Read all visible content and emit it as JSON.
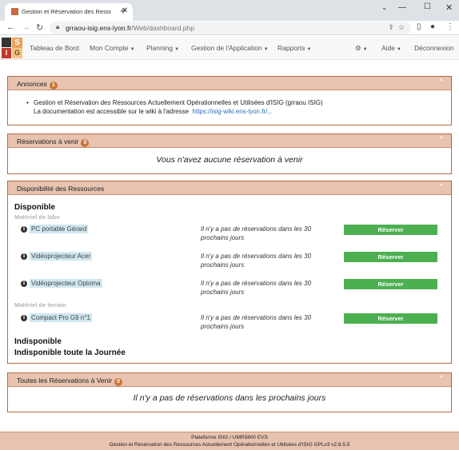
{
  "browser": {
    "tab_title": "Gestion et Réservation des Ressources",
    "url_host": "grraou-isig.ens-lyon.fr",
    "url_path": "/Web/dashboard.php"
  },
  "nav": {
    "items": [
      {
        "label": "Tableau de Bord",
        "dropdown": false
      },
      {
        "label": "Mon Compte",
        "dropdown": true
      },
      {
        "label": "Planning",
        "dropdown": true
      },
      {
        "label": "Gestion de l'Application",
        "dropdown": true
      },
      {
        "label": "Rapports",
        "dropdown": true
      }
    ],
    "help_label": "Aide",
    "logout_label": "Déconnexion",
    "logo_letters": [
      "",
      "S",
      "I",
      "G"
    ]
  },
  "announcements": {
    "title": "Annonces",
    "count": "1",
    "line1": "Gestion et Réservation des Ressources Actuellement Opérationnelles et Utilisées d'ISIG (grraou ISIG)",
    "line2": "La documentation est accessible sur le wiki à l'adresse",
    "link": "https://isig-wiki.ens-lyon.fr/..."
  },
  "upcoming": {
    "title": "Réservations à venir",
    "count": "0",
    "empty": "Vous n'avez aucune réservation à venir"
  },
  "availability": {
    "title": "Disponibilité des Ressources",
    "available_label": "Disponible",
    "categories": [
      {
        "name": "Matériel de labo",
        "resources": [
          {
            "name": "PC portable Gérard",
            "status": "Il n'y a pas de réservations dans les 30 prochains jours",
            "action": "Réserver"
          },
          {
            "name": "Vidéoprojecteur Acer",
            "status": "Il n'y a pas de réservations dans les 30 prochains jours",
            "action": "Réserver"
          },
          {
            "name": "Vidéoprojecteur Optoma",
            "status": "Il n'y a pas de réservations dans les 30 prochains jours",
            "action": "Réserver"
          }
        ]
      },
      {
        "name": "Matériel de terrain",
        "resources": [
          {
            "name": "Compact Pro G9 n°1",
            "status": "Il n'y a pas de réservations dans les 30 prochains jours",
            "action": "Réserver"
          }
        ]
      }
    ],
    "unavailable_label": "Indisponible",
    "unavailable_all_day_label": "Indisponible toute la Journée"
  },
  "all_upcoming": {
    "title": "Toutes les Réservations à Venir",
    "count": "0",
    "empty": "Il n'y a pas de réservations dans les prochains jours"
  },
  "footer": {
    "line1": "Plateforme ISIG / UMR5600 EVS",
    "line2": "Gestion et Réservation des Ressources Actuellement Opérationnelles et Utilisées d'ISIG GPLv3 v2.8.5.5"
  },
  "colors": {
    "panel_header": "#e7c3b0",
    "panel_border": "#b06a45",
    "badge": "#c9753a",
    "reserve_button": "#4caf50",
    "resource_highlight": "#cfe7f0"
  },
  "icons": [
    "favicon",
    "close-icon",
    "new-tab-icon",
    "back-icon",
    "forward-icon",
    "reload-icon",
    "lock-icon",
    "share-icon",
    "star-icon",
    "sidebar-icon",
    "profile-icon",
    "menu-icon",
    "gear-icon",
    "chevron-up-icon",
    "info-icon"
  ]
}
